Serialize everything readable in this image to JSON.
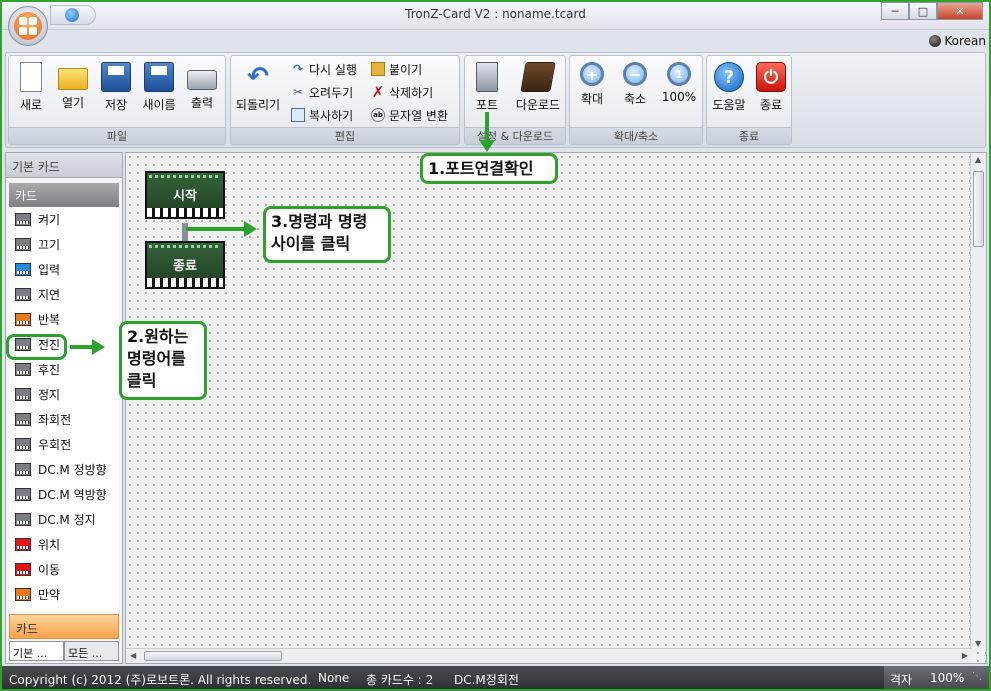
{
  "window": {
    "title": "TronZ-Card V2 : noname.tcard",
    "language": "Korean"
  },
  "ribbon": {
    "groups": [
      {
        "title": "파일",
        "buttons": [
          {
            "label": "새로",
            "icon": "new-file-icon"
          },
          {
            "label": "열기",
            "icon": "open-folder-icon"
          },
          {
            "label": "저장",
            "icon": "save-disk-icon"
          },
          {
            "label": "새이름",
            "icon": "save-as-disk-icon"
          },
          {
            "label": "출력",
            "icon": "printer-icon"
          }
        ]
      },
      {
        "title": "편집",
        "big": {
          "label": "되돌리기",
          "icon": "undo-icon"
        },
        "small": [
          {
            "label": "다시 실행",
            "icon": "redo-icon"
          },
          {
            "label": "붙이기",
            "icon": "paste-icon"
          },
          {
            "label": "오려두기",
            "icon": "cut-icon"
          },
          {
            "label": "삭제하기",
            "icon": "delete-icon"
          },
          {
            "label": "복사하기",
            "icon": "copy-icon"
          },
          {
            "label": "문자열 변환",
            "icon": "convert-string-icon"
          }
        ]
      },
      {
        "title": "설정 & 다운로드",
        "buttons": [
          {
            "label": "포트",
            "icon": "usb-port-icon"
          },
          {
            "label": "다운로드",
            "icon": "download-book-icon"
          }
        ]
      },
      {
        "title": "확대/축소",
        "buttons": [
          {
            "label": "확대",
            "icon": "zoom-in-icon"
          },
          {
            "label": "축소",
            "icon": "zoom-out-icon"
          },
          {
            "label": "100%",
            "icon": "zoom-reset-icon"
          }
        ]
      },
      {
        "title": "종료",
        "buttons": [
          {
            "label": "도움말",
            "icon": "help-icon"
          },
          {
            "label": "종료",
            "icon": "power-icon"
          }
        ]
      }
    ]
  },
  "left_panel": {
    "header": "기본 카드",
    "category": "카드",
    "items": [
      {
        "label": "켜기",
        "color": "#7a7f85"
      },
      {
        "label": "끄기",
        "color": "#7a7f85"
      },
      {
        "label": "입력",
        "color": "#1e8fe0"
      },
      {
        "label": "지연",
        "color": "#7a7f85"
      },
      {
        "label": "반복",
        "color": "#f07a18"
      },
      {
        "label": "전진",
        "color": "#7a7f85"
      },
      {
        "label": "후진",
        "color": "#7a7f85"
      },
      {
        "label": "정지",
        "color": "#7a7f85"
      },
      {
        "label": "좌회전",
        "color": "#7a7f85"
      },
      {
        "label": "우회전",
        "color": "#7a7f85"
      },
      {
        "label": "DC.M 정방향",
        "color": "#7a7f85"
      },
      {
        "label": "DC.M 역방향",
        "color": "#7a7f85"
      },
      {
        "label": "DC.M 정지",
        "color": "#7a7f85"
      },
      {
        "label": "위치",
        "color": "#e81414"
      },
      {
        "label": "이동",
        "color": "#e81414"
      },
      {
        "label": "만약",
        "color": "#f07a18"
      }
    ],
    "bottom_category": "카드",
    "tabs": [
      "기본 ...",
      "모든 ..."
    ]
  },
  "canvas": {
    "blocks": {
      "start": "시작",
      "end": "종료"
    }
  },
  "annotations": {
    "step1": "1.포트연결확인",
    "step2": "2.원하는 명령어를 클릭",
    "step3": "3.명령과 명령 사이를 클릭"
  },
  "status": {
    "copyright": "Copyright (c) 2012 (주)로보트론.  All rights reserved.",
    "none": "None",
    "card_count": "총 카드수 : 2",
    "selected": "DC.M정회전",
    "grid": "격자",
    "zoom": "100%"
  },
  "colors": {
    "annotation": "#2ca12c",
    "card_category_active": "#f7a34a"
  }
}
